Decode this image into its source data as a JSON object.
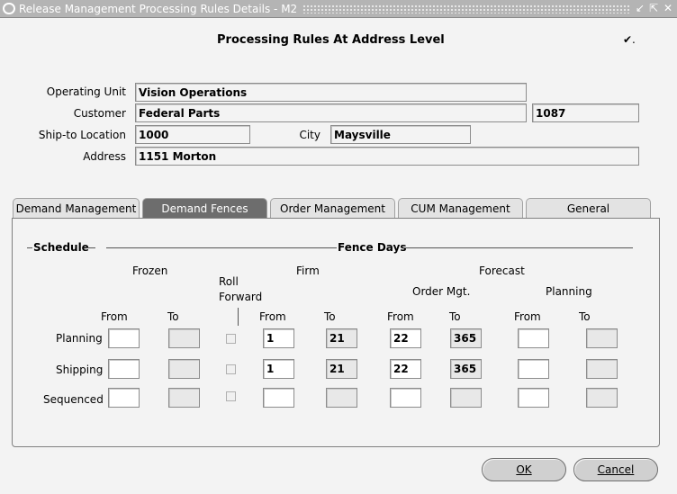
{
  "window": {
    "title": "Release Management Processing Rules Details - M2"
  },
  "header": {
    "title": "Processing Rules At Address Level",
    "check_mark": "✔."
  },
  "fields": {
    "operating_unit": {
      "label": "Operating Unit",
      "value": "Vision Operations"
    },
    "customer": {
      "label": "Customer",
      "value": "Federal Parts",
      "number": "1087"
    },
    "ship_to": {
      "label": "Ship-to Location",
      "value": "1000"
    },
    "city": {
      "label": "City",
      "value": "Maysville"
    },
    "address": {
      "label": "Address",
      "value": "1151 Morton"
    }
  },
  "tabs": [
    "Demand Management",
    "Demand Fences",
    "Order Management",
    "CUM Management",
    "General"
  ],
  "active_tab": "Demand Fences",
  "schedule": {
    "section_label": "Schedule",
    "fence_days_label": "Fence Days",
    "frozen": "Frozen",
    "roll_forward": [
      "Roll",
      "Forward"
    ],
    "firm": "Firm",
    "forecast": "Forecast",
    "order_mgt": "Order Mgt.",
    "planning_hdr": "Planning",
    "from": "From",
    "to": "To",
    "rows": [
      {
        "label": "Planning",
        "firm_from": "1",
        "firm_to": "21",
        "order_from": "22",
        "order_to": "365"
      },
      {
        "label": "Shipping",
        "firm_from": "1",
        "firm_to": "21",
        "order_from": "22",
        "order_to": "365"
      },
      {
        "label": "Sequenced",
        "firm_from": "",
        "firm_to": "",
        "order_from": "",
        "order_to": ""
      }
    ]
  },
  "buttons": {
    "ok": "OK",
    "cancel": "Cancel"
  }
}
